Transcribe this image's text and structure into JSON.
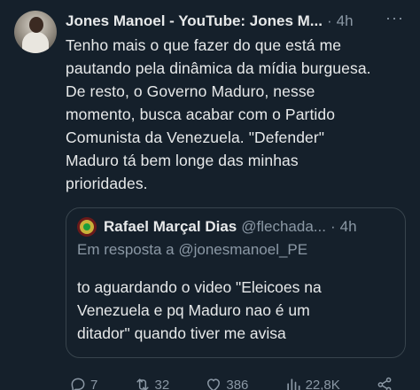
{
  "tweet": {
    "author_name": "Jones Manoel - YouTube: Jones M...",
    "separator": "·",
    "time": "4h",
    "more_label": "···",
    "text": "Tenho mais o que fazer do que está me\npautando pela dinâmica da mídia burguesa.\nDe resto, o Governo Maduro, nesse\nmomento, busca acabar com o Partido\nComunista da Venezuela. \"Defender\"\nMaduro tá bem longe das minhas\nprioridades."
  },
  "quote": {
    "author_name": "Rafael Marçal Dias",
    "handle": "@flechada...",
    "separator": "·",
    "time": "4h",
    "reply_to": "Em resposta a @jonesmanoel_PE",
    "text": "to aguardando o video \"Eleicoes na\nVenezuela e pq Maduro nao é um\nditador\" quando tiver me avisa"
  },
  "actions": {
    "replies": "7",
    "retweets": "32",
    "likes": "386",
    "views": "22,8K"
  },
  "colors": {
    "background": "#15202b",
    "text_primary": "#e7e9ea",
    "text_secondary": "#8b98a5",
    "border": "#38444d"
  }
}
